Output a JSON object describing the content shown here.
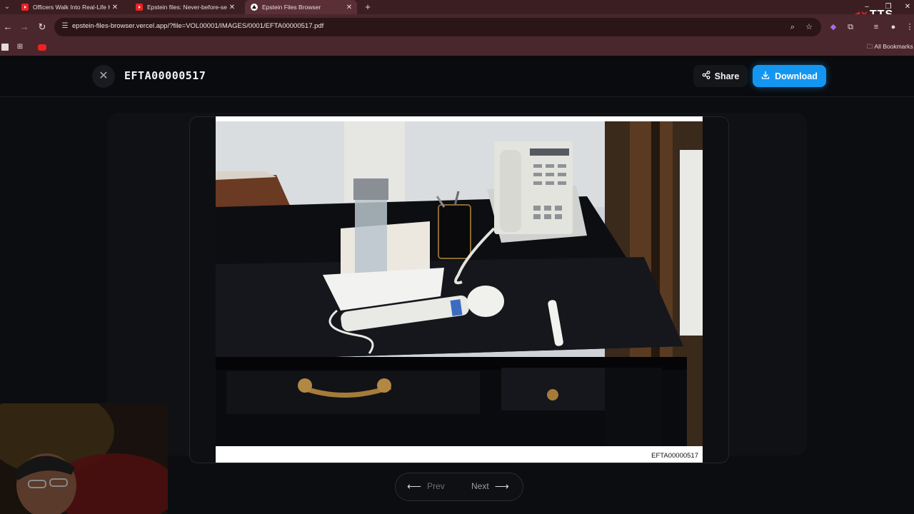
{
  "browser": {
    "tabs": [
      {
        "title": "Officers Walk Into Real-Life Ho",
        "favicon": "youtube-icon",
        "active": false
      },
      {
        "title": "Epstein files: Never-before-see",
        "favicon": "youtube-icon",
        "active": false
      },
      {
        "title": "Epstein Files Browser",
        "favicon": "vercel-icon",
        "active": true
      }
    ],
    "address": "epstein-files-browser.vercel.app/?file=VOL00001/IMAGES/0001/EFTA00000517.pdf",
    "bookmarks_label": "All Bookmarks",
    "overlay_text": "TTS"
  },
  "viewer": {
    "title": "EFTA00000517",
    "share_label": "Share",
    "download_label": "Download",
    "page_label": "EFTA00000517",
    "prev_label": "Prev",
    "next_label": "Next"
  },
  "colors": {
    "accent": "#1496f0",
    "tab_bar": "#3b1e22",
    "toolbar": "#4a272c",
    "page_bg": "#0c0d10"
  }
}
